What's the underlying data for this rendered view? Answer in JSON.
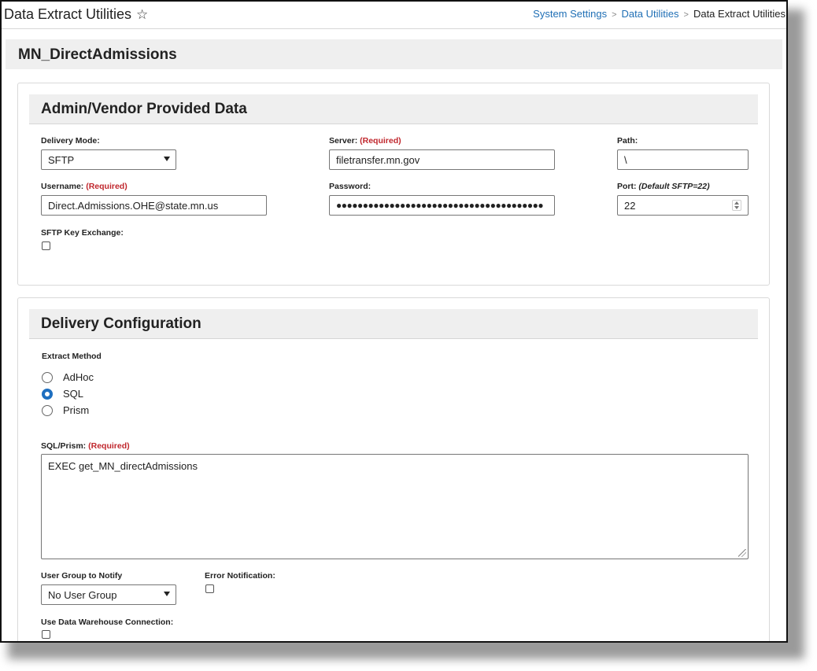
{
  "app": {
    "title": "Data Extract Utilities",
    "breadcrumb": [
      "System Settings",
      "Data Utilities",
      "Data Extract Utilities"
    ]
  },
  "page": {
    "title": "MN_DirectAdmissions"
  },
  "admin_section": {
    "title": "Admin/Vendor Provided Data",
    "delivery_mode": {
      "label": "Delivery Mode:",
      "value": "SFTP"
    },
    "server": {
      "label": "Server:",
      "required": "(Required)",
      "value": "filetransfer.mn.gov"
    },
    "path": {
      "label": "Path:",
      "value": "\\"
    },
    "username": {
      "label": "Username:",
      "required": "(Required)",
      "value": "Direct.Admissions.OHE@state.mn.us"
    },
    "password": {
      "label": "Password:",
      "value": "●●●●●●●●●●●●●●●●●●●●●●●●●●●●●●●●●●●●●●●"
    },
    "port": {
      "label": "Port:",
      "hint": "(Default SFTP=22)",
      "value": "22"
    },
    "sftp_key_exchange": {
      "label": "SFTP Key Exchange:",
      "checked": false
    }
  },
  "delivery_section": {
    "title": "Delivery Configuration",
    "extract_method": {
      "label": "Extract Method",
      "options": [
        "AdHoc",
        "SQL",
        "Prism"
      ],
      "selected": "SQL"
    },
    "sql_prism": {
      "label": "SQL/Prism:",
      "required": "(Required)",
      "value": "EXEC get_MN_directAdmissions"
    },
    "user_group": {
      "label": "User Group to Notify",
      "value": "No User Group"
    },
    "error_notification": {
      "label": "Error Notification:",
      "checked": false
    },
    "data_warehouse": {
      "label": "Use Data Warehouse Connection:",
      "checked": false
    }
  },
  "colors": {
    "link": "#1f6fb5",
    "required": "#c0272d",
    "radio_selected": "#1e6fc0"
  }
}
